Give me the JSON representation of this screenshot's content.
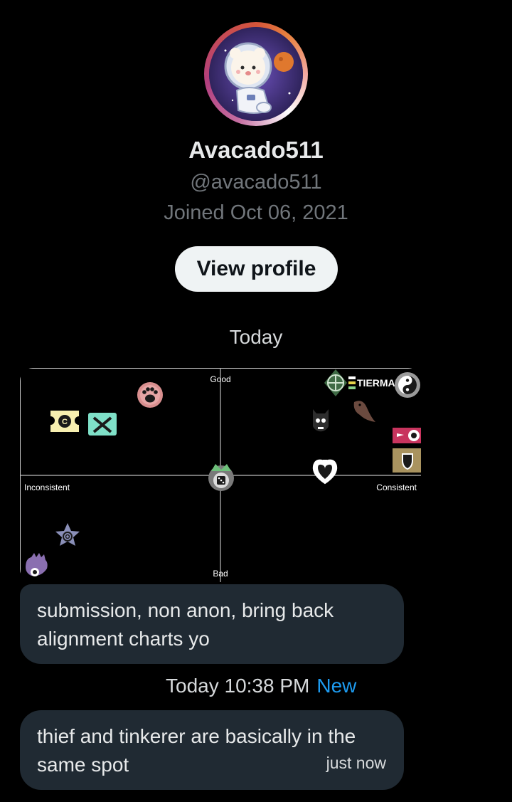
{
  "profile": {
    "display_name": "Avacado511",
    "handle": "@avacado511",
    "joined": "Joined Oct 06, 2021",
    "view_profile_label": "View profile",
    "avatar_icon": "astronaut-bear-avatar",
    "ring_colors": [
      "#d4543a",
      "#e8823f",
      "#ffffff",
      "#b23f7e"
    ]
  },
  "conversation": {
    "day_separator": "Today",
    "chart_image": {
      "labels": {
        "top": "Good",
        "bottom": "Bad",
        "left": "Inconsistent",
        "right": "Consistent"
      },
      "banner_text": "TIERMA'",
      "icons": [
        "ticket-icon",
        "crossed-tools-icon",
        "paw-icon",
        "target-icon",
        "yin-yang-icon",
        "cat-skull-icon",
        "bird-icon",
        "eye-card-icon",
        "shield-icon",
        "dice-crown-icon",
        "heart-icon",
        "spiral-star-icon",
        "eye-hand-icon"
      ]
    },
    "messages": [
      {
        "text": "submission, non anon, bring back alignment charts yo",
        "time": ""
      },
      {
        "text": "thief and tinkerer are basically in the same spot",
        "time": "just now"
      }
    ],
    "timestamp": {
      "label": "Today 10:38 PM",
      "new_label": "New",
      "new_color": "#1d9bf0"
    },
    "bubble_color": "#202a33"
  }
}
